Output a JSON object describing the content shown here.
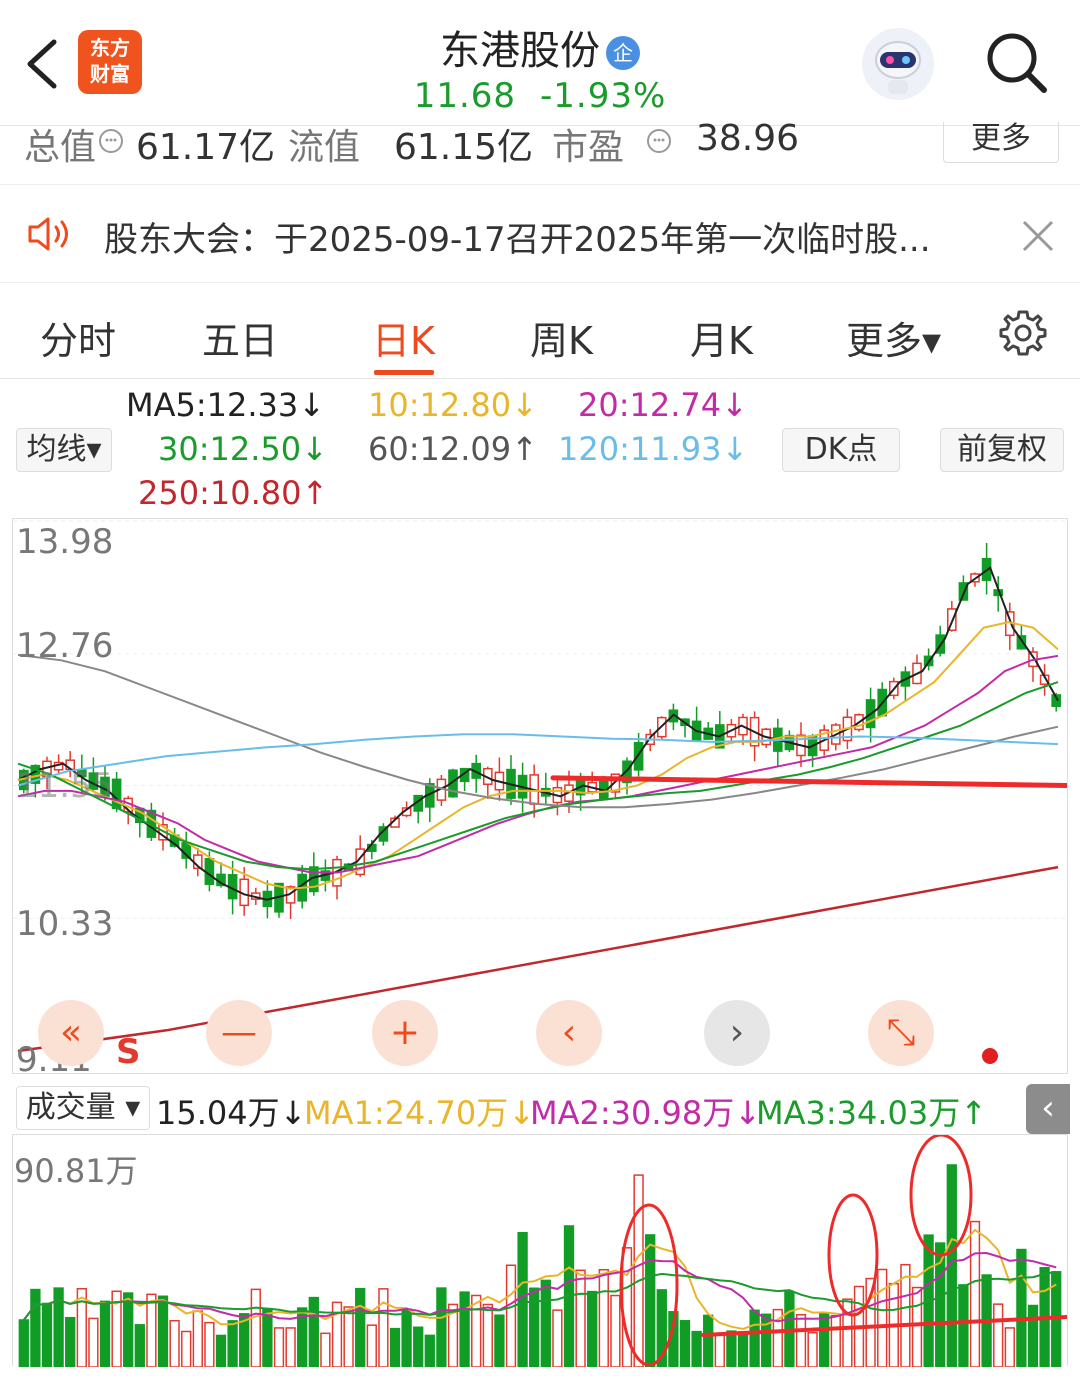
{
  "header": {
    "stock_name": "东港股份",
    "badge": "企",
    "price": "11.68",
    "change_pct": "-1.93%",
    "logo_text_1": "东方",
    "logo_text_2": "财富"
  },
  "stats": {
    "total_value_label": "总值",
    "total_value": "61.17亿",
    "float_value_label": "流值",
    "float_value": "61.15亿",
    "pe_label": "市盈",
    "pe_value": "38.96",
    "more_label": "更多"
  },
  "notice": {
    "text": "股东大会：于2025-09-17召开2025年第一次临时股..."
  },
  "tabs": [
    "分时",
    "五日",
    "日K",
    "周K",
    "月K",
    "更多▾"
  ],
  "active_tab": "日K",
  "ma_legend": {
    "ma_button": "均线▾",
    "ma5": "MA5:12.33↓",
    "ma10": "10:12.80↓",
    "ma20": "20:12.74↓",
    "ma30": "30:12.50↓",
    "ma60": "60:12.09↑",
    "ma120": "120:11.93↓",
    "ma250": "250:10.80↑",
    "dk_button": "DK点",
    "fq_button": "前复权"
  },
  "price_axis": {
    "top": "13.98",
    "upper": "12.76",
    "mid": "11.55",
    "lower": "10.33",
    "bottom": "9.11"
  },
  "signal_marker": "S",
  "nav_buttons": [
    "«",
    "—",
    "+",
    "‹",
    "›",
    "⤡"
  ],
  "volume": {
    "indicator": "成交量",
    "current": "15.04万↓",
    "ma1": "MA1:24.70万↓",
    "ma2": "MA2:30.98万↓",
    "ma3": "MA3:34.03万↑",
    "max_label": "90.81万",
    "collapse": "‹"
  },
  "colors": {
    "up": "#e23a2f",
    "down": "#119c26",
    "ma5": "#222222",
    "ma10": "#e9b52a",
    "ma20": "#c32ba6",
    "ma30": "#1a9b2c",
    "ma60": "#888888",
    "ma120": "#69bde8",
    "ma250": "#c0282e",
    "accent": "#ee4a1e"
  },
  "chart_data": {
    "type": "candlestick",
    "ylim": [
      9.11,
      13.98
    ],
    "ma_lines": {
      "ma5": [
        11.6,
        11.7,
        11.75,
        11.6,
        11.5,
        11.3,
        11.15,
        11.0,
        10.8,
        10.65,
        10.55,
        10.5,
        10.55,
        10.7,
        10.75,
        10.85,
        11.1,
        11.3,
        11.45,
        11.55,
        11.7,
        11.6,
        11.55,
        11.5,
        11.45,
        11.55,
        11.5,
        11.7,
        12.0,
        12.2,
        12.05,
        12.0,
        12.1,
        12.0,
        11.95,
        11.9,
        12.0,
        12.1,
        12.25,
        12.5,
        12.6,
        12.9,
        13.4,
        13.55,
        13.0,
        12.7,
        12.33
      ],
      "ma10": [
        11.6,
        11.65,
        11.6,
        11.5,
        11.4,
        11.3,
        11.15,
        11.0,
        10.85,
        10.75,
        10.65,
        10.6,
        10.62,
        10.7,
        10.8,
        10.9,
        11.05,
        11.2,
        11.35,
        11.45,
        11.5,
        11.5,
        11.5,
        11.48,
        11.5,
        11.55,
        11.65,
        11.8,
        11.9,
        11.95,
        11.95,
        12.0,
        12.0,
        12.05,
        12.1,
        12.2,
        12.35,
        12.5,
        12.75,
        13.0,
        13.05,
        13.0,
        12.8
      ],
      "ma20": [
        11.45,
        11.5,
        11.5,
        11.45,
        11.4,
        11.3,
        11.2,
        11.05,
        10.95,
        10.85,
        10.8,
        10.75,
        10.75,
        10.8,
        10.85,
        10.9,
        11.0,
        11.1,
        11.2,
        11.28,
        11.35,
        11.4,
        11.42,
        11.45,
        11.5,
        11.55,
        11.6,
        11.65,
        11.7,
        11.75,
        11.8,
        11.85,
        11.9,
        12.0,
        12.1,
        12.25,
        12.4,
        12.6,
        12.7,
        12.74
      ],
      "ma30": [
        11.75,
        11.65,
        11.5,
        11.35,
        11.2,
        11.05,
        10.95,
        10.85,
        10.8,
        10.78,
        10.8,
        10.85,
        10.95,
        11.05,
        11.15,
        11.25,
        11.32,
        11.38,
        11.42,
        11.45,
        11.48,
        11.5,
        11.55,
        11.6,
        11.65,
        11.72,
        11.8,
        11.9,
        12.0,
        12.1,
        12.25,
        12.4,
        12.5
      ],
      "ma60": [
        12.75,
        12.7,
        12.6,
        12.45,
        12.3,
        12.15,
        12.0,
        11.85,
        11.72,
        11.6,
        11.5,
        11.43,
        11.38,
        11.35,
        11.35,
        11.38,
        11.42,
        11.48,
        11.55,
        11.62,
        11.7,
        11.8,
        11.9,
        12.0,
        12.09
      ],
      "ma120": [
        11.55,
        11.68,
        11.75,
        11.82,
        11.86,
        11.9,
        11.93,
        11.97,
        12.0,
        12.02,
        12.02,
        12.0,
        11.98,
        11.97,
        11.95,
        11.96,
        11.98,
        12.0,
        11.99,
        11.97,
        11.95,
        11.93
      ],
      "ma250": [
        9.11,
        9.3,
        9.55,
        9.8,
        10.05,
        10.3,
        10.55,
        10.8
      ]
    }
  }
}
